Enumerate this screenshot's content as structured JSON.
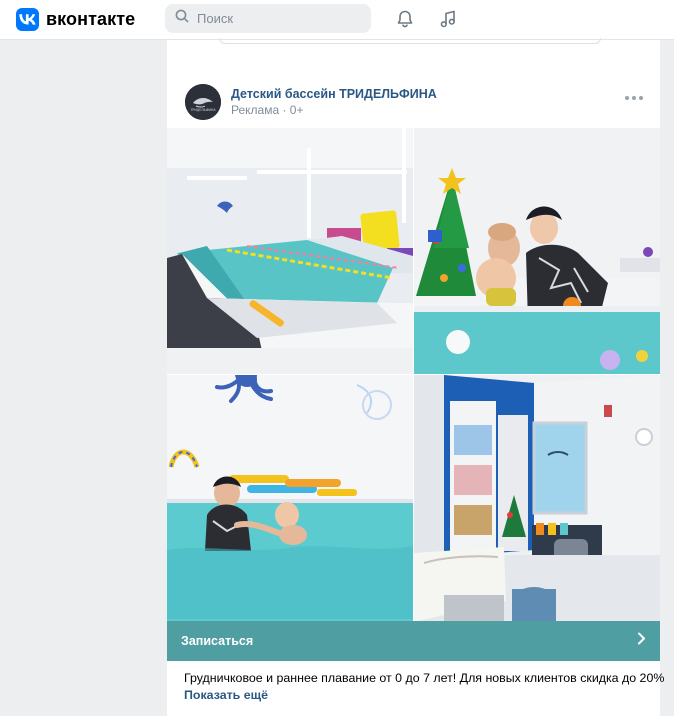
{
  "header": {
    "logo_text": "вконтакте",
    "search_placeholder": "Поиск",
    "icons": [
      "search-icon",
      "bell-icon",
      "music-icon"
    ]
  },
  "post": {
    "author": "Детский бассейн ТРИДЕЛЬФИНА",
    "label": "Реклама · 0+",
    "photos": [
      "Большая ванна бассейна с дорожками и игрушками на стене",
      "Мама с малышом в воде у ёлки",
      "Тренер плавает с ребёнком в бассейне",
      "Раздевалка с пеленальным столиком и шкафчиками"
    ],
    "cta_label": "Записаться",
    "description": "Грудничковое и раннее плавание от 0 до 7 лет! Для новых клиентов скидка до 20%",
    "show_more": "Показать ещё"
  },
  "colors": {
    "accent": "#0077ff",
    "link": "#2a5885",
    "cta": "#4f9ea2",
    "background": "#edeef0"
  }
}
